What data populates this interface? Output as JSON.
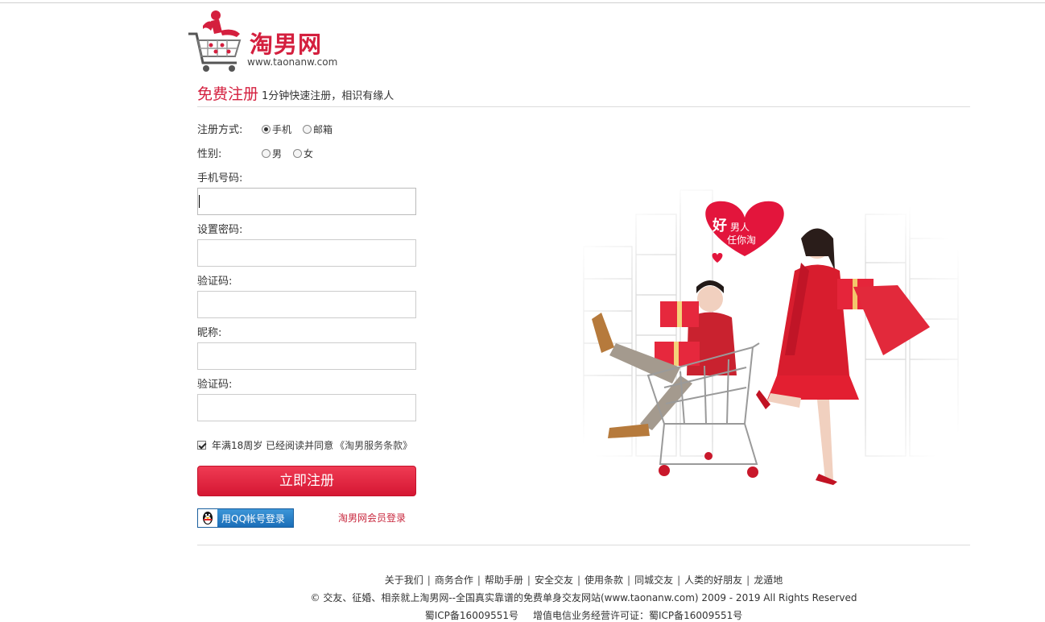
{
  "brand": {
    "name": "淘男网",
    "url": "www.taonanw.com",
    "accent": "#d41f3e"
  },
  "register": {
    "title": "免费注册",
    "subtitle": "1分钟快速注册，相识有缘人"
  },
  "form": {
    "method": {
      "label": "注册方式:",
      "options": [
        {
          "label": "手机",
          "selected": true
        },
        {
          "label": "邮箱",
          "selected": false
        }
      ]
    },
    "gender": {
      "label": "性别:",
      "options": [
        {
          "label": "男",
          "selected": false
        },
        {
          "label": "女",
          "selected": false
        }
      ]
    },
    "phone": {
      "label": "手机号码:",
      "value": ""
    },
    "password": {
      "label": "设置密码:",
      "value": ""
    },
    "captcha1": {
      "label": "验证码:",
      "value": ""
    },
    "nickname": {
      "label": "昵称:",
      "value": ""
    },
    "captcha2": {
      "label": "验证码:",
      "value": ""
    },
    "agree": {
      "checked": true,
      "text": "年满18周岁 已经阅读并同意",
      "terms": "《淘男服务条款》"
    },
    "submit_label": "立即注册"
  },
  "login": {
    "qq_label": "用QQ帐号登录",
    "member_label": "淘男网会员登录"
  },
  "hero": {
    "heart_big": "好",
    "heart_line1": "男人",
    "heart_line2": "任你淘"
  },
  "footer": {
    "links": [
      "关于我们",
      "商务合作",
      "帮助手册",
      "安全交友",
      "使用条款",
      "同城交友",
      "人类的好朋友",
      "龙遁地"
    ],
    "separator": "|",
    "copyright": "© 交友、征婚、相亲就上淘男网--全国真实靠谱的免费单身交友网站(www.taonanw.com) 2009 - 2019 All Rights Reserved",
    "icp1": "蜀ICP备16009551号",
    "icp2": "增值电信业务经营许可证：蜀ICP备16009551号"
  }
}
